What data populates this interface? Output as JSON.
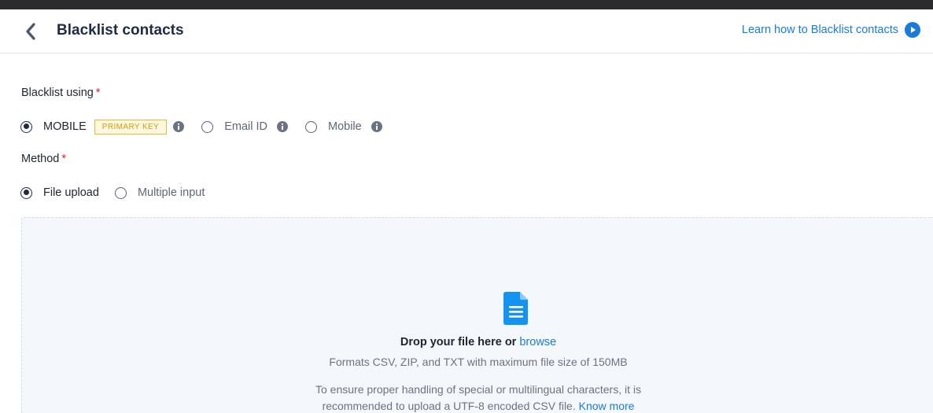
{
  "header": {
    "title": "Blacklist contacts",
    "learn_link": "Learn how to Blacklist contacts"
  },
  "blacklist_using": {
    "label": "Blacklist using",
    "required_mark": "*",
    "options": [
      {
        "label": "MOBILE",
        "selected": true,
        "badge": "PRIMARY KEY"
      },
      {
        "label": "Email ID",
        "selected": false
      },
      {
        "label": "Mobile",
        "selected": false
      }
    ]
  },
  "method": {
    "label": "Method",
    "required_mark": "*",
    "options": [
      {
        "label": "File upload",
        "selected": true
      },
      {
        "label": "Multiple input",
        "selected": false
      }
    ]
  },
  "dropzone": {
    "drop_text": "Drop your file here or",
    "browse_link": "browse",
    "formats_text": "Formats CSV, ZIP, and TXT with maximum file size of 150MB",
    "note_line1": "To ensure proper handling of special or multilingual characters, it is",
    "note_line2": "recommended to upload a UTF-8 encoded CSV file.",
    "know_more_link": "Know more"
  },
  "colors": {
    "accent": "#1a7bd8",
    "required": "#e0202a",
    "badge_border": "#e6b93c",
    "dropzone_bg": "#f4f8fd"
  },
  "icons": [
    "back-chevron-icon",
    "play-circle-icon",
    "info-icon",
    "document-icon"
  ]
}
